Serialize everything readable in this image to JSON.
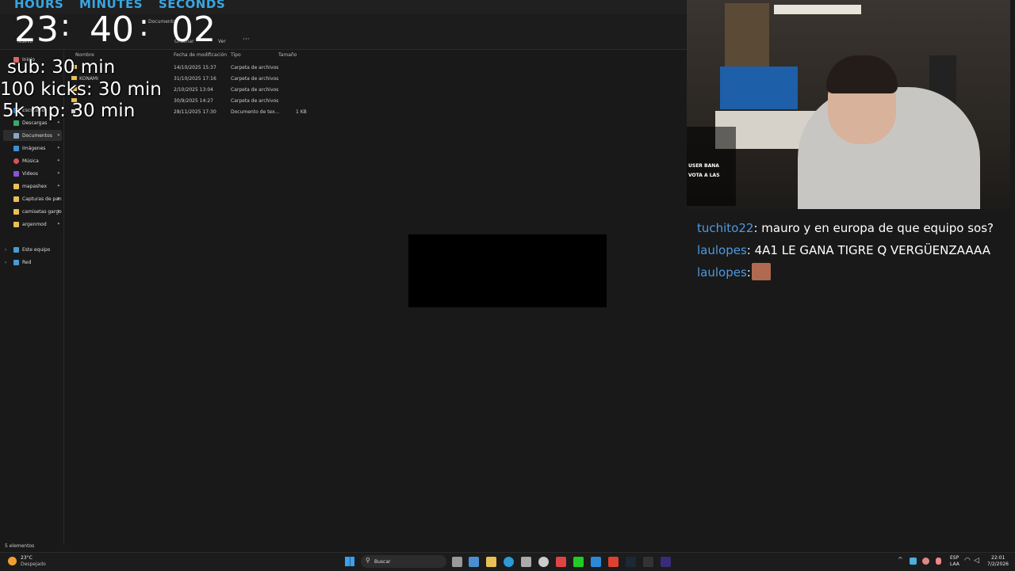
{
  "explorer": {
    "window_title": "Documentos",
    "breadcrumb": [
      "Documentos"
    ],
    "commands": {
      "new": "Nuevo",
      "sort": "Ordenar",
      "view": "Ver",
      "more": "···"
    },
    "columns": [
      "Nombre",
      "Fecha de modificación",
      "Tipo",
      "Tamaño"
    ],
    "sidebar": [
      {
        "label": "Inicio",
        "icon": "home-icon"
      },
      {
        "label": "Escritorio",
        "icon": "desktop-icon"
      },
      {
        "label": "Descargas",
        "icon": "download-icon"
      },
      {
        "label": "Documentos",
        "icon": "document-icon"
      },
      {
        "label": "Imágenes",
        "icon": "image-icon"
      },
      {
        "label": "Música",
        "icon": "music-icon"
      },
      {
        "label": "Videos",
        "icon": "video-icon"
      },
      {
        "label": "mapashex",
        "icon": "folder-icon"
      },
      {
        "label": "Capturas de pan",
        "icon": "folder-icon"
      },
      {
        "label": "camisetas gargo",
        "icon": "folder-icon"
      },
      {
        "label": "argenmod",
        "icon": "folder-icon"
      },
      {
        "label": "Este equipo",
        "icon": "computer-icon"
      },
      {
        "label": "Red",
        "icon": "network-icon"
      }
    ],
    "files": [
      {
        "name": "",
        "date": "14/10/2025 15:37",
        "type": "Carpeta de archivos",
        "size": ""
      },
      {
        "name": "KONAMI",
        "date": "31/10/2025 17:16",
        "type": "Carpeta de archivos",
        "size": ""
      },
      {
        "name": "",
        "date": "2/10/2025 13:04",
        "type": "Carpeta de archivos",
        "size": ""
      },
      {
        "name": "",
        "date": "30/9/2025 14:27",
        "type": "Carpeta de archivos",
        "size": ""
      },
      {
        "name": "",
        "date": "28/11/2025 17:30",
        "type": "Documento de tex...",
        "size": "1 KB"
      }
    ],
    "status": "5 elementos"
  },
  "timer": {
    "labels": {
      "hours": "HOURS",
      "minutes": "MINUTES",
      "seconds": "SECONDS"
    },
    "hours": "23",
    "minutes": "40",
    "seconds": "02",
    "sep": ":"
  },
  "goals": [
    "sub: 30 min",
    "100 kicks: 30 min",
    "5k mp: 30 min"
  ],
  "cam_chat": [
    "USER BANA",
    "VOTA A LAS"
  ],
  "chat": [
    {
      "user": "tuchito22",
      "message": "mauro y en europa de que equipo sos?"
    },
    {
      "user": "laulopes",
      "message": "4A1 LE GANA TIGRE Q VERGÜENZAAAA"
    },
    {
      "user": "laulopes",
      "message": ""
    }
  ],
  "taskbar": {
    "search": "Buscar",
    "weather_temp": "23°C",
    "weather_desc": "Despejado",
    "lang1": "ESP",
    "lang2": "LAA",
    "time": "22:01",
    "date": "7/2/2026"
  },
  "colors": {
    "accent": "#3aa6e0",
    "chat_user": "#4d9ae0",
    "folder": "#e8c054"
  }
}
